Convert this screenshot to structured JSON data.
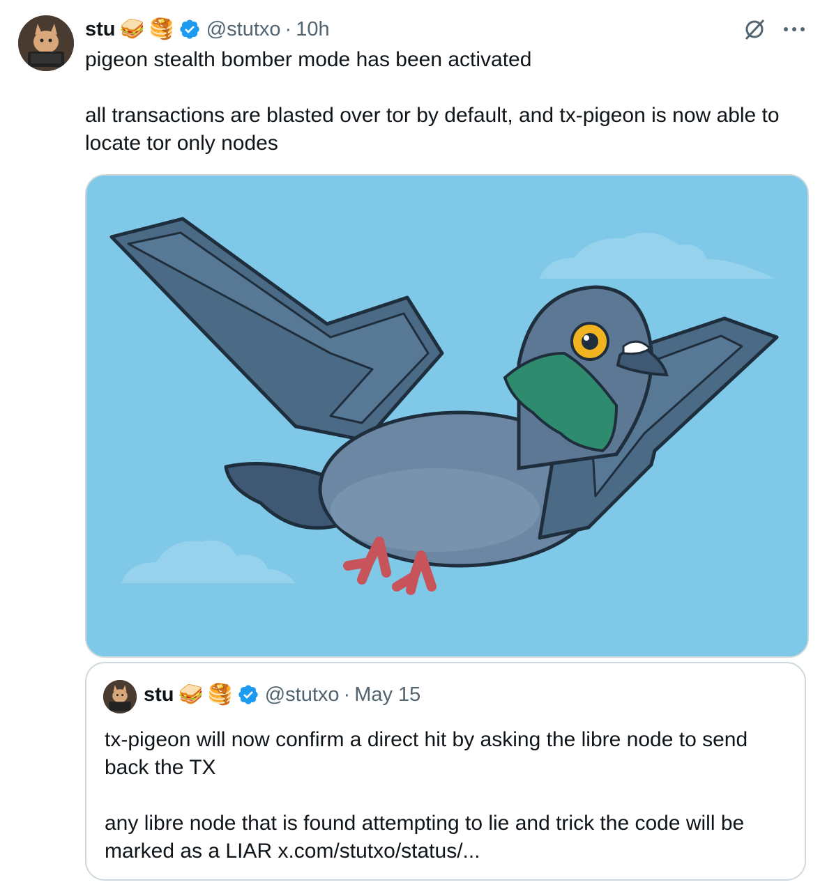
{
  "tweet": {
    "author_name": "stu",
    "emojis": [
      "🥪",
      "🥞"
    ],
    "verified_icon": "verified-badge-icon",
    "handle": "@stutxo",
    "separator": "·",
    "time": "10h",
    "text": "pigeon stealth bomber mode has been activated\n\nall transactions are blasted over tor by default, and tx-pigeon is now able to locate tor only nodes",
    "image_description_icon": "pigeon-stealth-bomber-illustration"
  },
  "quoted_tweet": {
    "author_name": "stu",
    "emojis": [
      "🥪",
      "🥞"
    ],
    "handle": "@stutxo",
    "separator": "·",
    "date": "May 15",
    "text": "tx-pigeon will now confirm a direct hit by asking the libre node to send back the TX\n\nany libre node that is found attempting to lie and trick the code will be marked as a LIAR x.com/stutxo/status/..."
  },
  "icons": {
    "grok": "grok-icon",
    "more": "more-options-icon"
  },
  "colors": {
    "verified": "#1d9bf0",
    "secondary_text": "#536471",
    "sky": "#7fc8e8"
  }
}
